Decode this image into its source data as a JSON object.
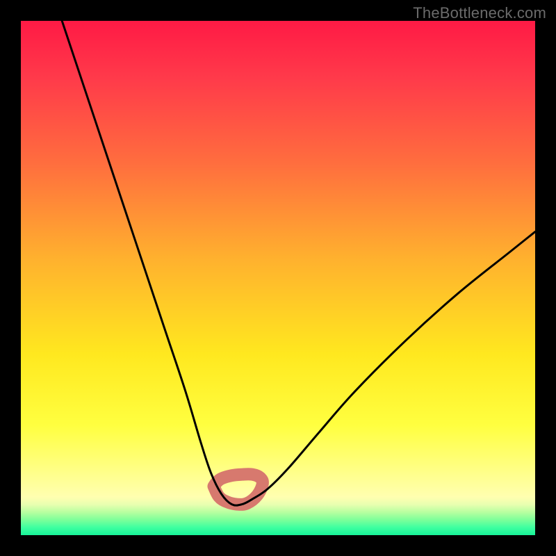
{
  "watermark": "TheBottleneck.com",
  "colors": {
    "frame": "#000000",
    "curve": "#000000",
    "bump": "#d7796e",
    "gradient_top": "#ff1a45",
    "gradient_mid": "#ffe81f",
    "gradient_bot": "#17f399"
  },
  "chart_data": {
    "type": "line",
    "title": "",
    "xlabel": "",
    "ylabel": "",
    "xlim": [
      0,
      100
    ],
    "ylim": [
      0,
      100
    ],
    "grid": false,
    "legend": false,
    "annotations": [],
    "series": [
      {
        "name": "bottleneck-curve",
        "x": [
          8,
          12,
          16,
          20,
          24,
          28,
          32,
          35,
          37,
          39,
          41,
          43,
          45,
          48,
          52,
          58,
          65,
          75,
          85,
          95,
          100
        ],
        "y": [
          100,
          88,
          76,
          64,
          52,
          40,
          28,
          18,
          12,
          8,
          6,
          6,
          7,
          9,
          13,
          20,
          28,
          38,
          47,
          55,
          59
        ]
      }
    ],
    "bump": {
      "name": "sweet-spot-marker",
      "x": [
        37.5,
        38.5,
        40,
        42,
        44,
        46,
        47,
        46.5,
        45,
        43,
        41,
        39,
        38
      ],
      "y": [
        9.5,
        7.5,
        6.5,
        6.0,
        6.2,
        7.8,
        10.0,
        11.2,
        11.8,
        11.8,
        11.6,
        11.0,
        10.2
      ]
    }
  }
}
